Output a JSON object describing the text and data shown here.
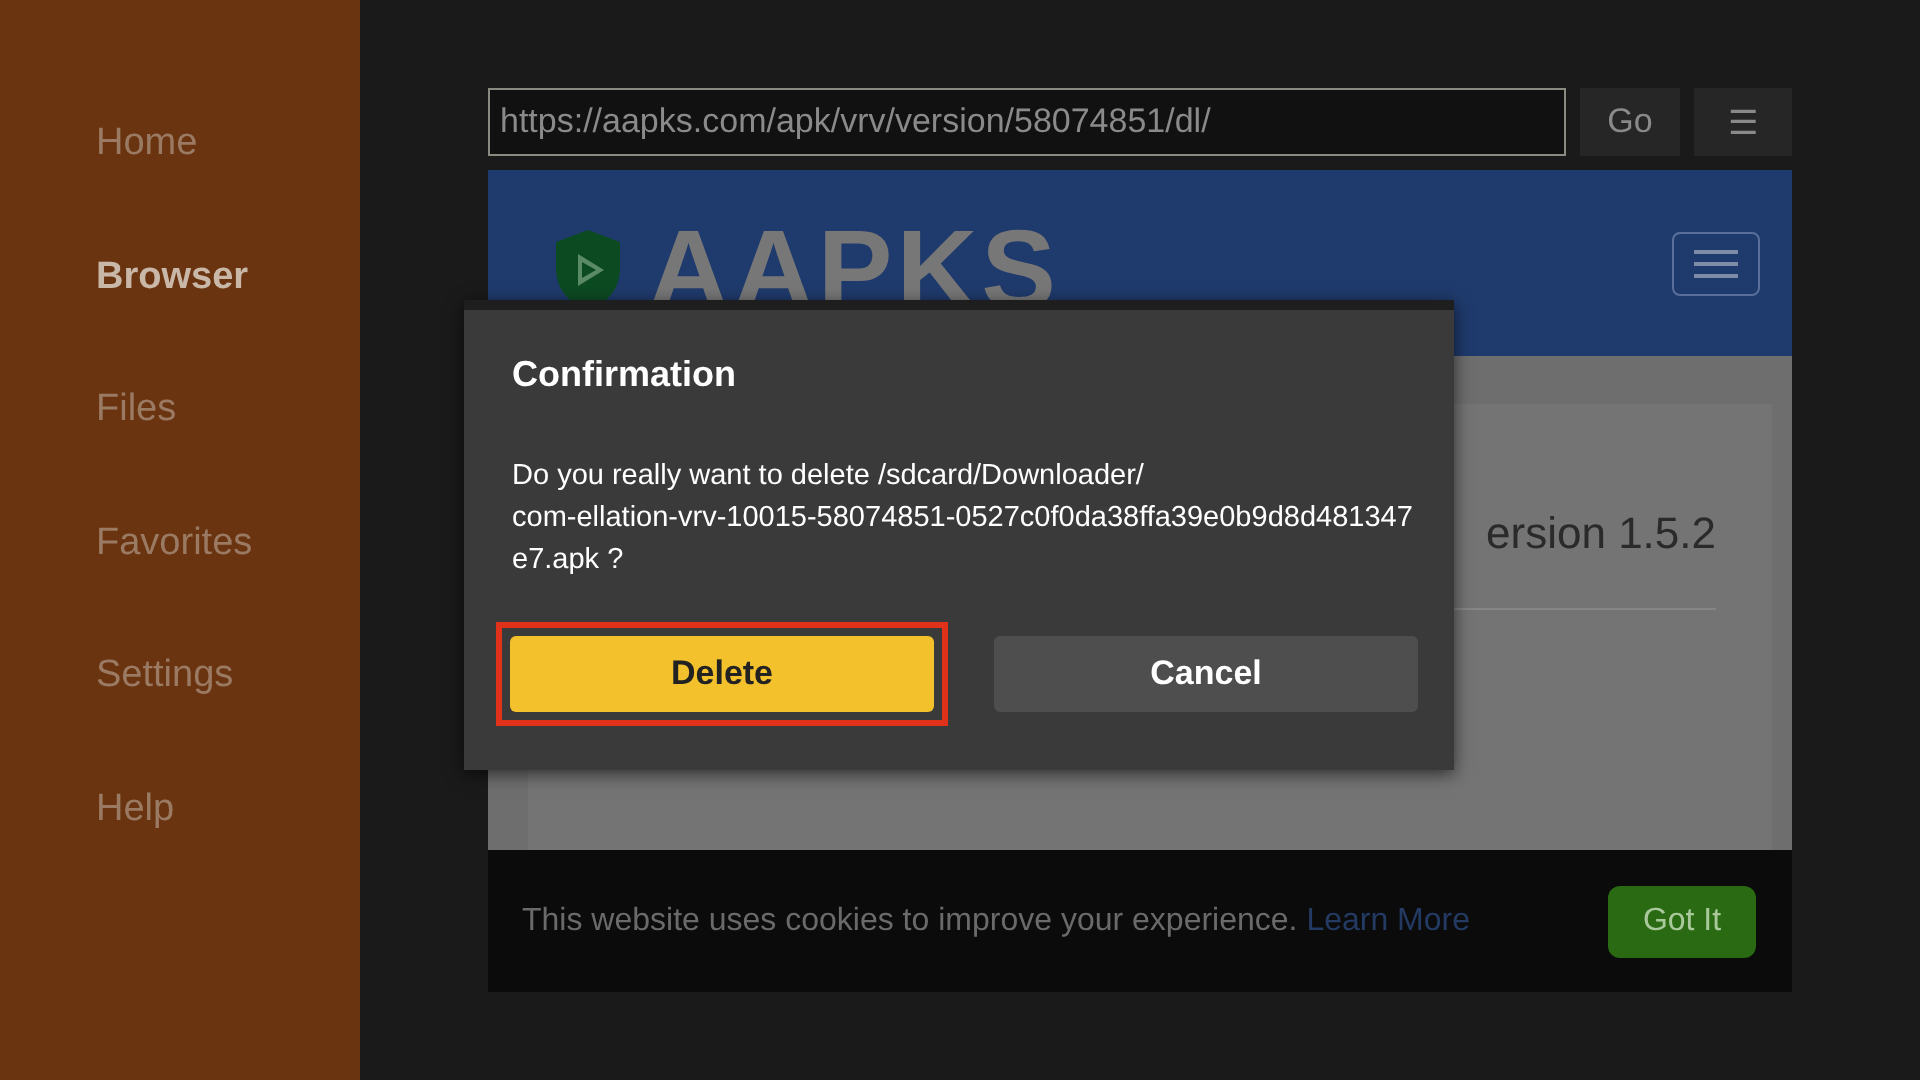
{
  "sidebar": {
    "items": [
      {
        "label": "Home",
        "selected": false
      },
      {
        "label": "Browser",
        "selected": true
      },
      {
        "label": "Files",
        "selected": false
      },
      {
        "label": "Favorites",
        "selected": false
      },
      {
        "label": "Settings",
        "selected": false
      },
      {
        "label": "Help",
        "selected": false
      }
    ]
  },
  "address_bar": {
    "value": "https://aapks.com/apk/vrv/version/58074851/dl/",
    "go_button": "Go",
    "menu_button": "☰"
  },
  "web_page": {
    "logo_text": "AAPKS",
    "heading": "ersion 1.5.2",
    "cookie_banner": {
      "text": "This website uses cookies to improve your experience.",
      "link": "Learn More",
      "button": "Got It"
    }
  },
  "dialog": {
    "title": "Confirmation",
    "message": "Do you really want to delete /sdcard/Downloader/\ncom-ellation-vrv-10015-58074851-0527c0f0da38ffa39e0b9d8d481347e7.apk ?",
    "buttons": [
      {
        "label": "Delete",
        "selected": true
      },
      {
        "label": "Cancel",
        "selected": false
      }
    ]
  }
}
